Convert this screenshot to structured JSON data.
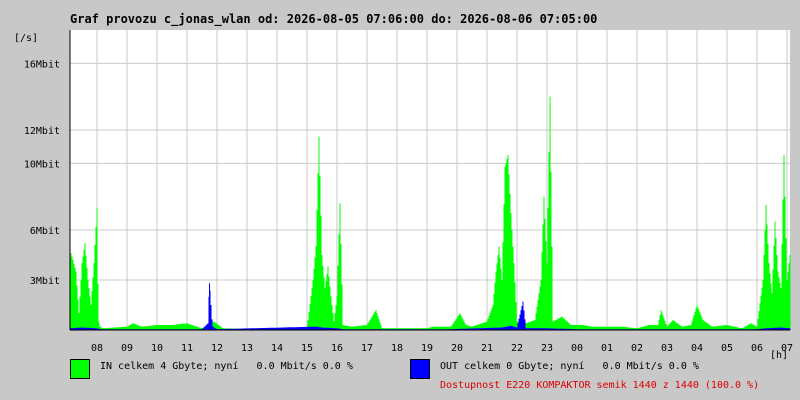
{
  "chart_data": {
    "type": "line",
    "title": "Graf provozu c_jonas_wlan od: 2026-08-05 07:06:00 do: 2026-08-06 07:05:00",
    "ylabel": "[/s]",
    "xlabel": "[h]",
    "x_ticks": [
      "08",
      "09",
      "10",
      "11",
      "12",
      "13",
      "14",
      "15",
      "16",
      "17",
      "18",
      "19",
      "20",
      "21",
      "22",
      "23",
      "00",
      "01",
      "02",
      "03",
      "04",
      "05",
      "06",
      "07"
    ],
    "y_ticks": [
      {
        "label": "3Mbit",
        "value": 3
      },
      {
        "label": "6Mbit",
        "value": 6
      },
      {
        "label": "10Mbit",
        "value": 10
      },
      {
        "label": "12Mbit",
        "value": 12
      },
      {
        "label": "16Mbit",
        "value": 16
      }
    ],
    "ylim": [
      0,
      18
    ],
    "xlim_hours": [
      7.1,
      31.1
    ],
    "grid": true,
    "series": [
      {
        "name": "IN",
        "color": "#00ff00",
        "points": [
          [
            7.1,
            4.8
          ],
          [
            7.2,
            4.2
          ],
          [
            7.3,
            3.5
          ],
          [
            7.4,
            1.0
          ],
          [
            7.5,
            4.0
          ],
          [
            7.6,
            5.2
          ],
          [
            7.7,
            3.0
          ],
          [
            7.8,
            1.5
          ],
          [
            7.9,
            4.0
          ],
          [
            8.0,
            7.3
          ],
          [
            8.05,
            0.5
          ],
          [
            8.1,
            0.2
          ],
          [
            8.2,
            0.1
          ],
          [
            9.0,
            0.2
          ],
          [
            9.2,
            0.4
          ],
          [
            9.5,
            0.2
          ],
          [
            10.0,
            0.3
          ],
          [
            10.5,
            0.3
          ],
          [
            11.0,
            0.4
          ],
          [
            11.5,
            0.1
          ],
          [
            11.9,
            0.5
          ],
          [
            12.2,
            0.1
          ],
          [
            13,
            0.05
          ],
          [
            14,
            0.05
          ],
          [
            15,
            0.1
          ],
          [
            15.2,
            3.0
          ],
          [
            15.3,
            5.0
          ],
          [
            15.4,
            11.6
          ],
          [
            15.5,
            4.5
          ],
          [
            15.6,
            2.5
          ],
          [
            15.7,
            3.8
          ],
          [
            15.8,
            2.0
          ],
          [
            15.9,
            0.5
          ],
          [
            16.0,
            2.0
          ],
          [
            16.1,
            7.6
          ],
          [
            16.2,
            0.3
          ],
          [
            16.5,
            0.2
          ],
          [
            17.0,
            0.3
          ],
          [
            17.3,
            1.2
          ],
          [
            17.5,
            0.1
          ],
          [
            18.0,
            0.1
          ],
          [
            19.0,
            0.1
          ],
          [
            19.2,
            0.2
          ],
          [
            19.8,
            0.2
          ],
          [
            20.1,
            1.0
          ],
          [
            20.3,
            0.3
          ],
          [
            20.5,
            0.2
          ],
          [
            21.0,
            0.5
          ],
          [
            21.2,
            1.5
          ],
          [
            21.3,
            3.5
          ],
          [
            21.4,
            5.0
          ],
          [
            21.5,
            3.0
          ],
          [
            21.6,
            9.8
          ],
          [
            21.7,
            10.5
          ],
          [
            21.8,
            7.0
          ],
          [
            21.9,
            4.0
          ],
          [
            22.0,
            0.5
          ],
          [
            22.3,
            0.4
          ],
          [
            22.6,
            0.6
          ],
          [
            22.8,
            3.0
          ],
          [
            22.9,
            8.0
          ],
          [
            23.0,
            4.0
          ],
          [
            23.1,
            14.0
          ],
          [
            23.2,
            0.5
          ],
          [
            23.5,
            0.8
          ],
          [
            23.8,
            0.3
          ],
          [
            24.2,
            0.3
          ],
          [
            24.5,
            0.2
          ],
          [
            25.0,
            0.2
          ],
          [
            25.5,
            0.2
          ],
          [
            26.0,
            0.1
          ],
          [
            26.4,
            0.3
          ],
          [
            26.7,
            0.3
          ],
          [
            26.8,
            1.2
          ],
          [
            27.0,
            0.2
          ],
          [
            27.2,
            0.6
          ],
          [
            27.5,
            0.2
          ],
          [
            27.8,
            0.3
          ],
          [
            28.0,
            1.5
          ],
          [
            28.2,
            0.6
          ],
          [
            28.5,
            0.2
          ],
          [
            29.0,
            0.3
          ],
          [
            29.5,
            0.1
          ],
          [
            29.8,
            0.4
          ],
          [
            30.0,
            0.2
          ],
          [
            30.2,
            3.0
          ],
          [
            30.3,
            7.5
          ],
          [
            30.4,
            4.0
          ],
          [
            30.5,
            2.2
          ],
          [
            30.6,
            6.5
          ],
          [
            30.7,
            3.5
          ],
          [
            30.8,
            2.5
          ],
          [
            30.9,
            10.5
          ],
          [
            31.0,
            3.0
          ],
          [
            31.1,
            4.5
          ]
        ]
      },
      {
        "name": "OUT",
        "color": "#0000ff",
        "points": [
          [
            7.1,
            0.1
          ],
          [
            7.5,
            0.15
          ],
          [
            8.0,
            0.1
          ],
          [
            8.1,
            0.05
          ],
          [
            11.5,
            0.05
          ],
          [
            11.7,
            0.4
          ],
          [
            11.75,
            2.8
          ],
          [
            11.8,
            1.5
          ],
          [
            11.85,
            0.2
          ],
          [
            12.0,
            0.05
          ],
          [
            15.3,
            0.2
          ],
          [
            15.5,
            0.15
          ],
          [
            16.0,
            0.1
          ],
          [
            16.2,
            0.05
          ],
          [
            19.8,
            0.05
          ],
          [
            21.5,
            0.15
          ],
          [
            21.8,
            0.25
          ],
          [
            22.0,
            0.15
          ],
          [
            22.2,
            1.7
          ],
          [
            22.3,
            0.1
          ],
          [
            23.0,
            0.1
          ],
          [
            24.0,
            0.05
          ],
          [
            30.0,
            0.05
          ],
          [
            30.3,
            0.1
          ],
          [
            30.8,
            0.15
          ],
          [
            31.1,
            0.1
          ]
        ]
      }
    ]
  },
  "legend": {
    "in_label": "IN celkem 4 Gbyte; nyní   0.0 Mbit/s 0.0 %",
    "in_color": "#00ff00",
    "out_label": "OUT celkem 0 Gbyte; nyní   0.0 Mbit/s 0.0 %",
    "out_color": "#0000ff"
  },
  "availability": {
    "text": "Dostupnost E220 KOMPAKTOR semik 1440 z 1440 (100.0 %)",
    "color": "#e00000"
  }
}
